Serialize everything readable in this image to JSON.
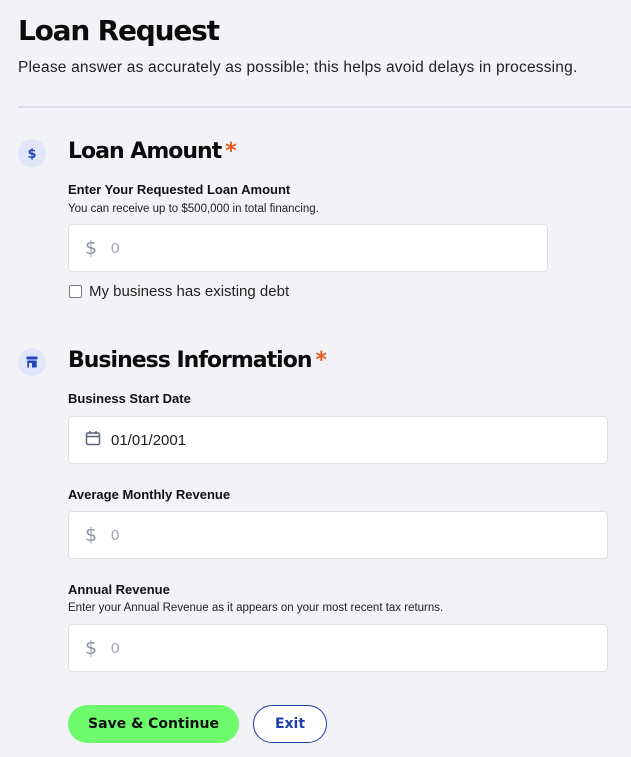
{
  "header": {
    "title": "Loan Request",
    "subtitle": "Please answer as accurately as possible; this helps avoid delays in processing."
  },
  "loan_amount": {
    "icon": "dollar-icon",
    "title": "Loan Amount",
    "required_mark": "*",
    "field_label": "Enter Your Requested Loan Amount",
    "field_help": "You can receive up to $500,000 in total financing.",
    "currency_symbol": "$",
    "placeholder": "0",
    "checkbox_label": "My business has existing debt",
    "checkbox_checked": false
  },
  "business_info": {
    "icon": "storefront-icon",
    "title": "Business Information",
    "required_mark": "*",
    "start_date_label": "Business Start Date",
    "start_date_value": "01/01/2001",
    "monthly_revenue_label": "Average Monthly Revenue",
    "monthly_revenue_placeholder": "0",
    "annual_revenue_label": "Annual Revenue",
    "annual_revenue_help": "Enter your Annual Revenue as it appears on your most recent tax returns.",
    "annual_revenue_placeholder": "0",
    "currency_symbol": "$"
  },
  "actions": {
    "primary_label": "Save & Continue",
    "secondary_label": "Exit"
  },
  "colors": {
    "accent_required": "#e8571b",
    "primary_button": "#6dfb6b",
    "secondary_border": "#1f3fa8",
    "icon_bg": "#e2e6fa",
    "icon_fg": "#2445b8"
  }
}
